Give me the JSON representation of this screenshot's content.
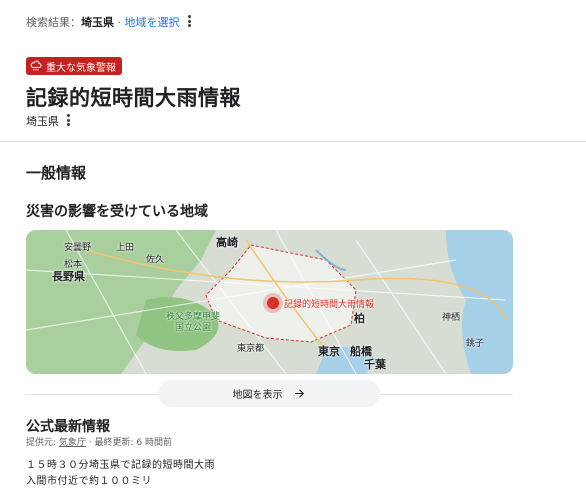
{
  "breadcrumb": {
    "prefix": "検索結果：",
    "location": "埼玉県",
    "separator": " · ",
    "select_region": "地域を選択"
  },
  "alert": {
    "badge_label": "重大な気象警報",
    "icon": "weather-warning-icon",
    "color": "#c5221f",
    "title": "記録的短時間大雨情報",
    "region": "埼玉県"
  },
  "general": {
    "heading": "一般情報",
    "affected_heading": "災害の影響を受けている地域"
  },
  "map": {
    "labels": {
      "annaka": "安曇野",
      "ueda": "上田",
      "saku": "佐久",
      "matsumoto": "松本",
      "nagano": "長野県",
      "takasaki": "高崎",
      "chichibu_park": "秩父多摩甲斐\n国立公園",
      "tokyo_to": "東京都",
      "tokyo": "東京",
      "funabashi": "船橋",
      "chiba": "千葉",
      "kashiwa": "柏",
      "kamisu": "神栖",
      "choshi": "銚子",
      "area_marker": "記録的短時間大雨情報"
    },
    "show_map_button": "地図を表示"
  },
  "official": {
    "heading": "公式最新情報",
    "provider_prefix": "提供元: ",
    "provider": "気象庁",
    "updated": " · 最終更新: 6 時間前",
    "lines": [
      "１５時３０分埼玉県で記録的短時間大雨",
      "入間市付近で約１００ミリ"
    ]
  },
  "colors": {
    "accent": "#1a73e8",
    "alert": "#c5221f",
    "area_outline": "#d93025"
  }
}
